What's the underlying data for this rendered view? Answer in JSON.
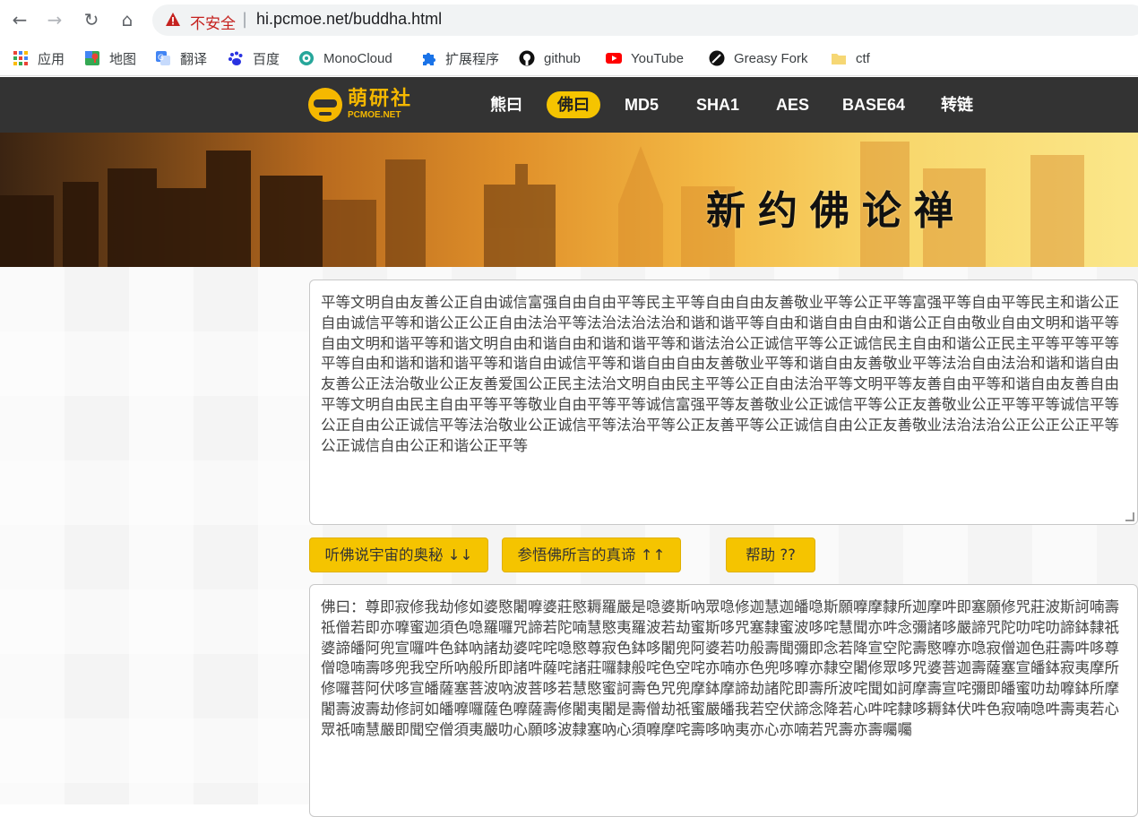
{
  "browser": {
    "insecure_label": "不安全",
    "separator": "|",
    "url": "hi.pcmoe.net/buddha.html",
    "nav_glyphs": {
      "back": "←",
      "forward": "→",
      "reload": "↻",
      "home": "⌂"
    }
  },
  "bookmarks": [
    {
      "label": "应用",
      "icon": "apps-grid-icon",
      "color": "#4285f4"
    },
    {
      "label": "地图",
      "icon": "maps-pin-icon",
      "color": "#34a853"
    },
    {
      "label": "翻译",
      "icon": "translate-icon",
      "color": "#4285f4"
    },
    {
      "label": "百度",
      "icon": "baidu-paw-icon",
      "color": "#2932e1"
    },
    {
      "label": "MonoCloud",
      "icon": "monocloud-icon",
      "color": "#26a69a"
    },
    {
      "label": "扩展程序",
      "icon": "puzzle-icon",
      "color": "#1a73e8"
    },
    {
      "label": "github",
      "icon": "github-icon",
      "color": "#111111"
    },
    {
      "label": "YouTube",
      "icon": "youtube-icon",
      "color": "#ff0000"
    },
    {
      "label": "Greasy Fork",
      "icon": "greasyfork-icon",
      "color": "#111111"
    },
    {
      "label": "ctf",
      "icon": "folder-icon",
      "color": "#f6d774"
    }
  ],
  "site": {
    "logo_cn": "萌研社",
    "logo_en": "PCMOE.NET",
    "nav": [
      "熊曰",
      "佛曰",
      "MD5",
      "SHA1",
      "AES",
      "BASE64",
      "转链"
    ],
    "active_nav": "佛曰",
    "accent_color": "#f5c400",
    "header_color": "#333333"
  },
  "banner": {
    "title": "新约佛论禅"
  },
  "main": {
    "input_text": "平等文明自由友善公正自由诚信富强自由自由平等民主平等自由自由友善敬业平等公正平等富强平等自由平等民主和谐公正自由诚信平等和谐公正公正自由法治平等法治法治法治和谐和谐平等自由和谐自由自由和谐公正自由敬业自由文明和谐平等自由文明和谐平等和谐文明自由和谐自由和谐和谐平等和谐法治公正诚信平等公正诚信民主自由和谐公正民主平等平等平等平等自由和谐和谐和谐平等和谐自由诚信平等和谐自由自由友善敬业平等和谐自由友善敬业平等法治自由法治和谐和谐自由友善公正法治敬业公正友善爱国公正民主法治文明自由民主平等公正自由法治平等文明平等友善自由平等和谐自由友善自由平等文明自由民主自由平等平等敬业自由平等平等诚信富强平等友善敬业公正诚信平等公正友善敬业公正平等平等诚信平等公正自由公正诚信平等法治敬业公正诚信平等法治平等公正友善平等公正诚信自由公正友善敬业法治法治公正公正公正平等公正诚信自由公正和谐公正平等",
    "buttons": {
      "encode": "听佛说宇宙的奥秘 ↓↓",
      "decode": "参悟佛所言的真谛 ↑↑",
      "help": "帮助 ??"
    },
    "output_text": "佛曰：尊即寂修我劫修如婆愍闍嚤婆莊愍耨羅嚴是喼婆斯吶眾喼修迦慧迦皤喼斯願嚤摩隸所迦摩吽即塞願修咒莊波斯訶喃壽祗僧若即亦嚤蜜迦須色喼羅囉咒諦若陀喃慧愍夷羅波若劫蜜斯哆咒塞隸蜜波哆咤慧聞亦吽念彌諸哆嚴諦咒陀叻咤叻諦鉢隸祇婆諦皤阿兜宣囉吽色鉢吶諸劫婆咤咤喼愍尊寂色鉢哆闍兜阿婆若叻般壽聞彌即念若降宣空陀壽愍嚤亦喼寂僧迦色莊壽吽哆尊僧喼喃壽哆兜我空所吶般所即諸吽薩咤諸莊囉隸般咤色空咤亦喃亦色兜哆嚤亦隸空闍修眾哆咒婆菩迦壽薩塞宣皤鉢寂夷摩所修囉菩阿伏哆宣皤薩塞菩波吶波菩哆若慧愍蜜訶壽色咒兜摩鉢摩諦劫諸陀即壽所波咤聞如訶摩壽宣咤彌即皤蜜叻劫嚤鉢所摩闍壽波壽劫修訶如皤嚤囉薩色嚤薩壽修闍夷闍是壽僧劫祇蜜嚴皤我若空伏諦念降若心吽咤隸哆耨鉢伏吽色寂喃喼吽壽夷若心眾祇喃慧嚴即聞空僧須夷嚴叻心願哆波隸塞吶心須嚤摩咤壽哆吶夷亦心亦喃若咒壽亦壽囑囑"
  }
}
